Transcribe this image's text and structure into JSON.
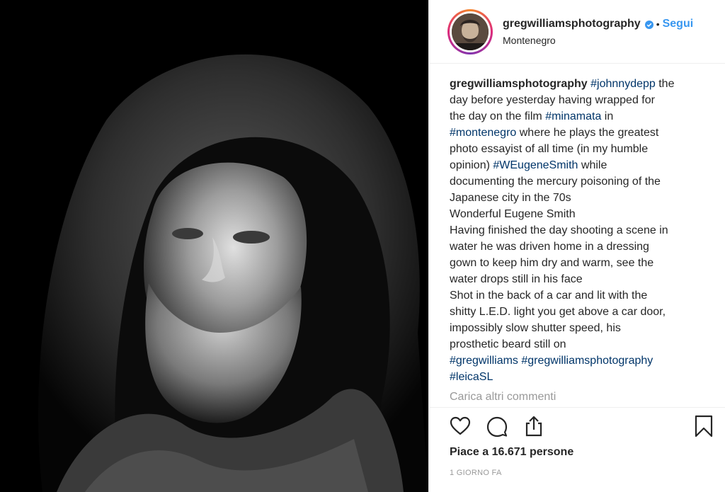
{
  "header": {
    "username": "gregwilliamsphotography",
    "separator": "•",
    "follow_label": "Segui",
    "location": "Montenegro"
  },
  "caption": {
    "username": "gregwilliamsphotography",
    "lines": [
      [
        {
          "t": " "
        },
        {
          "t": "#johnnydepp",
          "tag": true
        },
        {
          "t": " the"
        }
      ],
      [
        {
          "t": "day before yesterday having wrapped for"
        }
      ],
      [
        {
          "t": "the day on the film "
        },
        {
          "t": "#minamata",
          "tag": true
        },
        {
          "t": " in"
        }
      ],
      [
        {
          "t": "#montenegro",
          "tag": true
        },
        {
          "t": " where he plays the greatest"
        }
      ],
      [
        {
          "t": "photo essayist of all time (in my humble"
        }
      ],
      [
        {
          "t": "opinion) "
        },
        {
          "t": "#WEugeneSmith",
          "tag": true
        },
        {
          "t": " while"
        }
      ],
      [
        {
          "t": "documenting the mercury poisoning of the"
        }
      ],
      [
        {
          "t": "Japanese city in the 70s"
        }
      ],
      [
        {
          "t": "Wonderful Eugene Smith"
        }
      ],
      [
        {
          "t": "Having finished the day shooting a scene in"
        }
      ],
      [
        {
          "t": "water he was driven home in a dressing"
        }
      ],
      [
        {
          "t": "gown to keep him dry and warm, see the"
        }
      ],
      [
        {
          "t": "water drops still in his face"
        }
      ],
      [
        {
          "t": "Shot in the back of a car and lit with the"
        }
      ],
      [
        {
          "t": "shitty L.E.D. light you get above a car door,"
        }
      ],
      [
        {
          "t": "impossibly slow shutter speed, his"
        }
      ],
      [
        {
          "t": "prosthetic beard still on"
        }
      ],
      [
        {
          "t": "#gregwilliams",
          "tag": true
        },
        {
          "t": " "
        },
        {
          "t": "#gregwilliamsphotography",
          "tag": true
        }
      ],
      [
        {
          "t": "#leicaSL",
          "tag": true
        }
      ]
    ]
  },
  "comments": {
    "load_more_label": "Carica altri commenti"
  },
  "actions": {
    "like_icon": "heart-icon",
    "comment_icon": "comment-icon",
    "share_icon": "share-icon",
    "save_icon": "bookmark-icon"
  },
  "likes_text": "Piace a 16.671 persone",
  "timestamp": "1 GIORNO FA",
  "colors": {
    "link": "#3897f0",
    "hashtag": "#003569",
    "muted": "#999999",
    "text": "#262626"
  }
}
